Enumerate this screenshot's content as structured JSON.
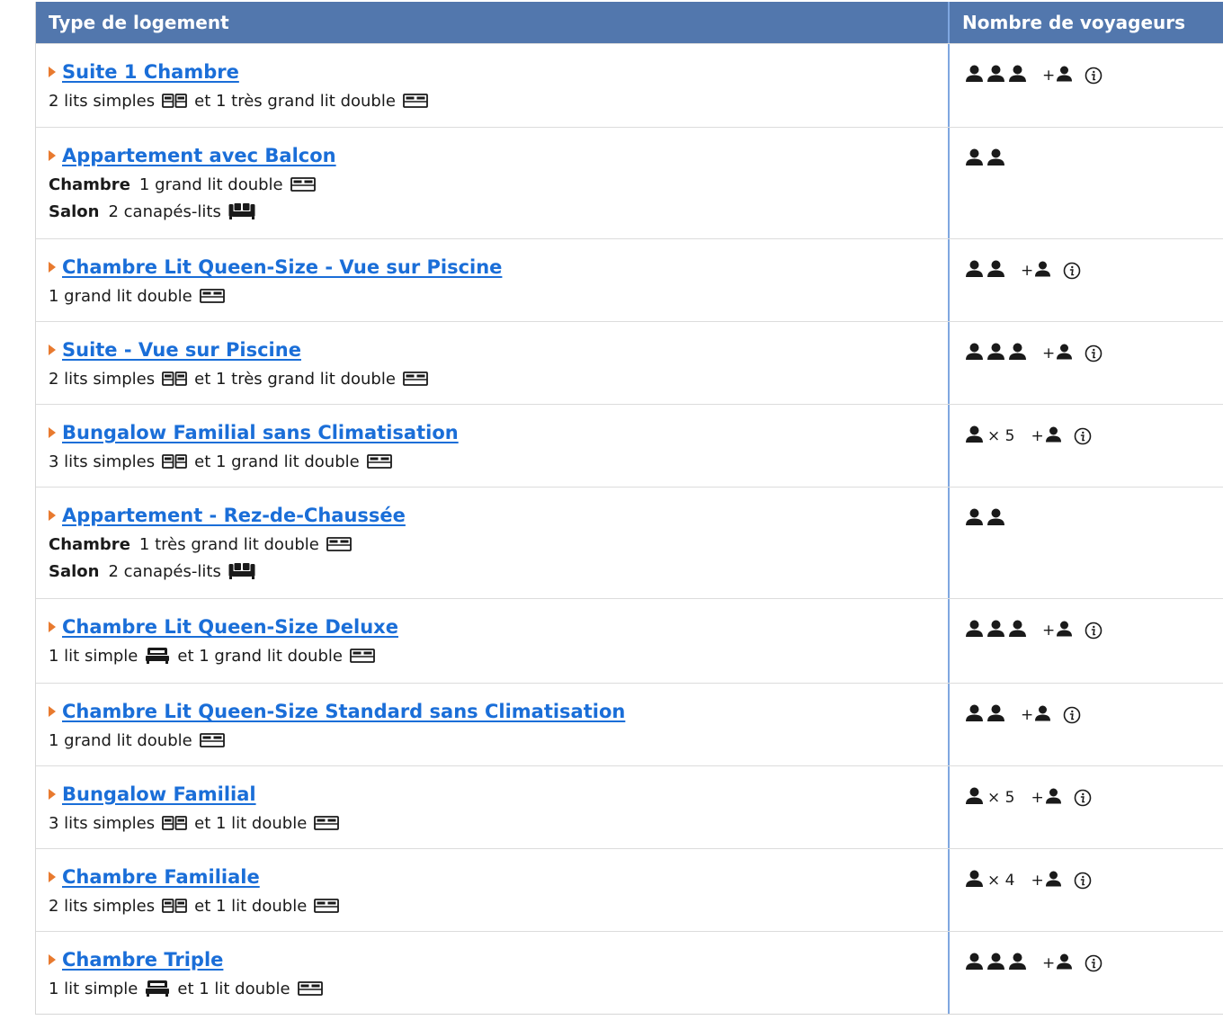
{
  "header": {
    "col1": "Type de logement",
    "col2": "Nombre de voyageurs"
  },
  "colors": {
    "header_bg": "#5277ad",
    "link": "#1a6ed8",
    "triangle": "#e87a2f",
    "divider": "#7fa7e0"
  },
  "icons": {
    "person": "person-icon",
    "info": "info-icon",
    "single_bed": "single-bed-icon",
    "double_bed": "double-bed-icon",
    "sofa_bed": "sofa-bed-icon"
  },
  "rooms": [
    {
      "name": "Suite 1 Chambre",
      "height": 93,
      "lines": [
        {
          "label": "",
          "parts": [
            {
              "text": "2 lits simples",
              "icon": "twin"
            },
            {
              "text": "et 1 très grand lit double",
              "icon": "double"
            }
          ]
        }
      ],
      "guests": {
        "count": 3,
        "times": "",
        "extra": true,
        "plus": "+"
      }
    },
    {
      "name": "Appartement avec Balcon",
      "height": 124,
      "lines": [
        {
          "label": "Chambre",
          "parts": [
            {
              "text": "1 grand lit double",
              "icon": "double"
            }
          ]
        },
        {
          "label": "Salon",
          "parts": [
            {
              "text": "2 canapés-lits",
              "icon": "sofa"
            }
          ]
        }
      ],
      "guests": {
        "count": 2,
        "times": "",
        "extra": false,
        "plus": ""
      }
    },
    {
      "name": "Chambre Lit Queen-Size - Vue sur Piscine",
      "height": 92,
      "lines": [
        {
          "label": "",
          "parts": [
            {
              "text": "1 grand lit double",
              "icon": "double"
            }
          ]
        }
      ],
      "guests": {
        "count": 2,
        "times": "",
        "extra": true,
        "plus": "+"
      }
    },
    {
      "name": "Suite - Vue sur Piscine",
      "height": 92,
      "lines": [
        {
          "label": "",
          "parts": [
            {
              "text": "2 lits simples",
              "icon": "twin"
            },
            {
              "text": "et 1 très grand lit double",
              "icon": "double"
            }
          ]
        }
      ],
      "guests": {
        "count": 3,
        "times": "",
        "extra": true,
        "plus": "+"
      }
    },
    {
      "name": "Bungalow Familial sans Climatisation",
      "height": 92,
      "lines": [
        {
          "label": "",
          "parts": [
            {
              "text": "3 lits simples",
              "icon": "twin"
            },
            {
              "text": "et 1 grand lit double",
              "icon": "double"
            }
          ]
        }
      ],
      "guests": {
        "count": 1,
        "times": "× 5",
        "extra": true,
        "plus": "+"
      }
    },
    {
      "name": "Appartement - Rez-de-Chaussée",
      "height": 124,
      "lines": [
        {
          "label": "Chambre",
          "parts": [
            {
              "text": "1 très grand lit double",
              "icon": "double"
            }
          ]
        },
        {
          "label": "Salon",
          "parts": [
            {
              "text": "2 canapés-lits",
              "icon": "sofa"
            }
          ]
        }
      ],
      "guests": {
        "count": 2,
        "times": "",
        "extra": false,
        "plus": ""
      }
    },
    {
      "name": "Chambre Lit Queen-Size Deluxe",
      "height": 94,
      "lines": [
        {
          "label": "",
          "parts": [
            {
              "text": "1 lit simple",
              "icon": "single"
            },
            {
              "text": "et 1 grand lit double",
              "icon": "double"
            }
          ]
        }
      ],
      "guests": {
        "count": 3,
        "times": "",
        "extra": true,
        "plus": "+"
      }
    },
    {
      "name": "Chambre Lit Queen-Size Standard sans Climatisation",
      "height": 92,
      "lines": [
        {
          "label": "",
          "parts": [
            {
              "text": "1 grand lit double",
              "icon": "double"
            }
          ]
        }
      ],
      "guests": {
        "count": 2,
        "times": "",
        "extra": true,
        "plus": "+"
      }
    },
    {
      "name": "Bungalow Familial",
      "height": 92,
      "lines": [
        {
          "label": "",
          "parts": [
            {
              "text": "3 lits simples",
              "icon": "twin"
            },
            {
              "text": "et 1 lit double",
              "icon": "double"
            }
          ]
        }
      ],
      "guests": {
        "count": 1,
        "times": "× 5",
        "extra": true,
        "plus": "+"
      }
    },
    {
      "name": "Chambre Familiale",
      "height": 92,
      "lines": [
        {
          "label": "",
          "parts": [
            {
              "text": "2 lits simples",
              "icon": "twin"
            },
            {
              "text": "et 1 lit double",
              "icon": "double"
            }
          ]
        }
      ],
      "guests": {
        "count": 1,
        "times": "× 4",
        "extra": true,
        "plus": "+"
      }
    },
    {
      "name": "Chambre Triple",
      "height": 92,
      "lines": [
        {
          "label": "",
          "parts": [
            {
              "text": "1 lit simple",
              "icon": "single"
            },
            {
              "text": "et 1 lit double",
              "icon": "double"
            }
          ]
        }
      ],
      "guests": {
        "count": 3,
        "times": "",
        "extra": true,
        "plus": "+"
      }
    }
  ]
}
